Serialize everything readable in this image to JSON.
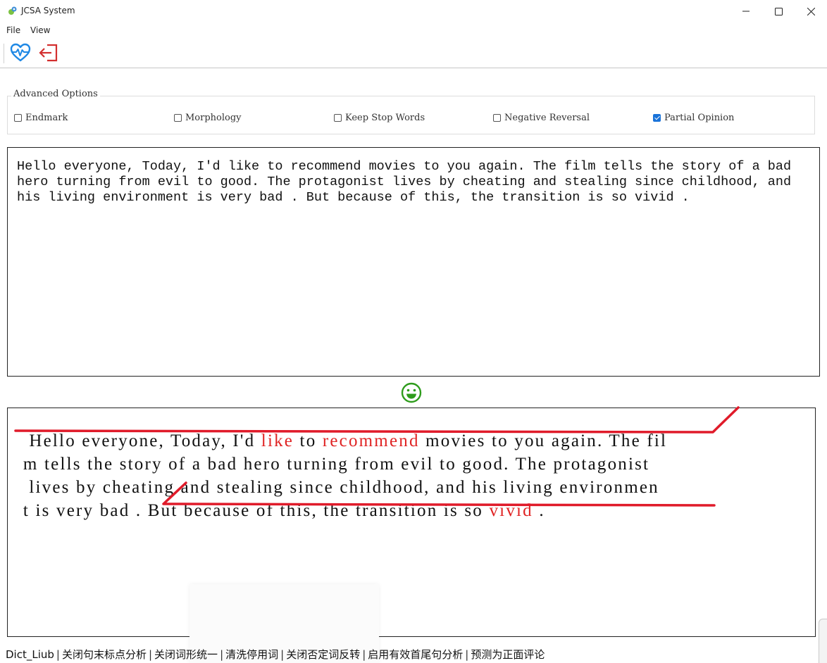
{
  "window": {
    "title": "JCSA System",
    "app_icon": "app-logo-icon",
    "controls": {
      "minimize": "minimize-icon",
      "maximize": "maximize-icon",
      "close": "close-icon"
    }
  },
  "menu": {
    "file": "File",
    "view": "View"
  },
  "toolbar": {
    "heart_icon": "heart-pulse-icon",
    "exit_icon": "exit-icon",
    "heart_color": "#1e88e5",
    "exit_color": "#d32f2f"
  },
  "options": {
    "legend": "Advanced Options",
    "items": [
      {
        "label": "Endmark",
        "checked": false
      },
      {
        "label": "Morphology",
        "checked": false
      },
      {
        "label": "Keep Stop Words",
        "checked": false
      },
      {
        "label": "Negative Reversal",
        "checked": false
      },
      {
        "label": "Partial Opinion",
        "checked": true
      }
    ]
  },
  "input": {
    "text": "Hello everyone, Today, I'd like to recommend movies to you again. The film tells the story of a bad hero turning from evil to good. The protagonist lives by cheating and stealing since childhood, and his living environment is very bad . But because of this, the transition is so vivid ."
  },
  "result": {
    "icon": "smiley-icon",
    "color": "#2e9c1c"
  },
  "output": {
    "lines": [
      [
        {
          "t": " Hello everyone, Today, I'd ",
          "hl": false
        },
        {
          "t": "like",
          "hl": true
        },
        {
          "t": " to ",
          "hl": false
        },
        {
          "t": "recommend",
          "hl": true
        },
        {
          "t": " movies to you again. The fil",
          "hl": false
        }
      ],
      [
        {
          "t": "m tells the story of a bad hero turning from evil to good. The protagonist",
          "hl": false
        }
      ],
      [
        {
          "t": " lives by cheating and stealing since childhood, and his living environmen",
          "hl": false
        }
      ],
      [
        {
          "t": "t is very bad . But because of this, the transition is so ",
          "hl": false
        },
        {
          "t": "vivid",
          "hl": true
        },
        {
          "t": " .",
          "hl": false
        }
      ]
    ],
    "highlight_color": "#e02424"
  },
  "status": {
    "items": [
      "Dict_Liub",
      "关闭句末标点分析",
      "关闭词形统一",
      "清洗停用词",
      "关闭否定词反转",
      "启用有效首尾句分析",
      "预测为正面评论"
    ]
  }
}
